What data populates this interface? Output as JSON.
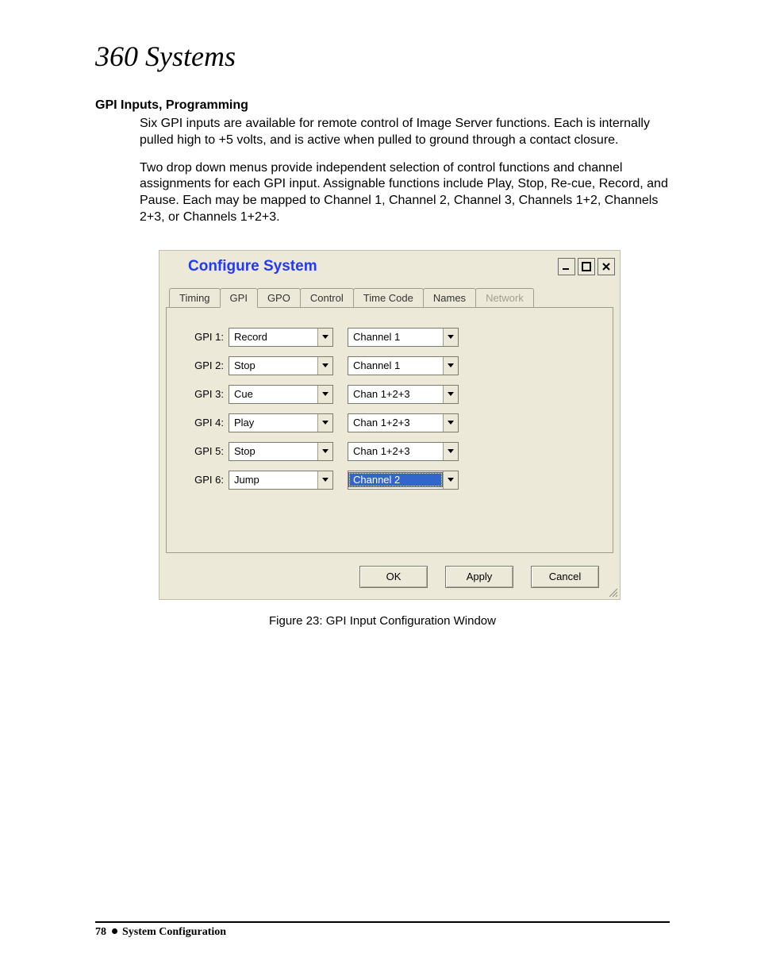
{
  "logo": "360 Systems",
  "heading": "GPI Inputs, Programming",
  "para1": "Six GPI inputs are available for remote control of Image Server functions. Each is internally pulled high to +5 volts, and is active when pulled to ground through a contact closure.",
  "para2": "Two drop down menus provide independent selection of control functions and channel assignments for each GPI input.  Assignable functions include Play, Stop, Re-cue, Record, and Pause. Each may be mapped to Channel 1, Channel 2, Channel 3, Channels 1+2, Channels 2+3, or Channels 1+2+3.",
  "dialog": {
    "title": "Configure System",
    "tabs": {
      "timing": "Timing",
      "gpi": "GPI",
      "gpo": "GPO",
      "control": "Control",
      "timecode": "Time Code",
      "names": "Names",
      "network": "Network"
    },
    "rows": {
      "r1": {
        "label": "GPI 1:",
        "func": "Record",
        "chan": "Channel 1"
      },
      "r2": {
        "label": "GPI 2:",
        "func": "Stop",
        "chan": "Channel 1"
      },
      "r3": {
        "label": "GPI 3:",
        "func": "Cue",
        "chan": "Chan 1+2+3"
      },
      "r4": {
        "label": "GPI 4:",
        "func": "Play",
        "chan": "Chan 1+2+3"
      },
      "r5": {
        "label": "GPI 5:",
        "func": "Stop",
        "chan": "Chan 1+2+3"
      },
      "r6": {
        "label": "GPI 6:",
        "func": "Jump",
        "chan": "Channel 2"
      }
    },
    "buttons": {
      "ok": "OK",
      "apply": "Apply",
      "cancel": "Cancel"
    }
  },
  "figure_caption": "Figure 23:  GPI Input Configuration Window",
  "footer": {
    "page": "78",
    "section": "System Configuration"
  }
}
